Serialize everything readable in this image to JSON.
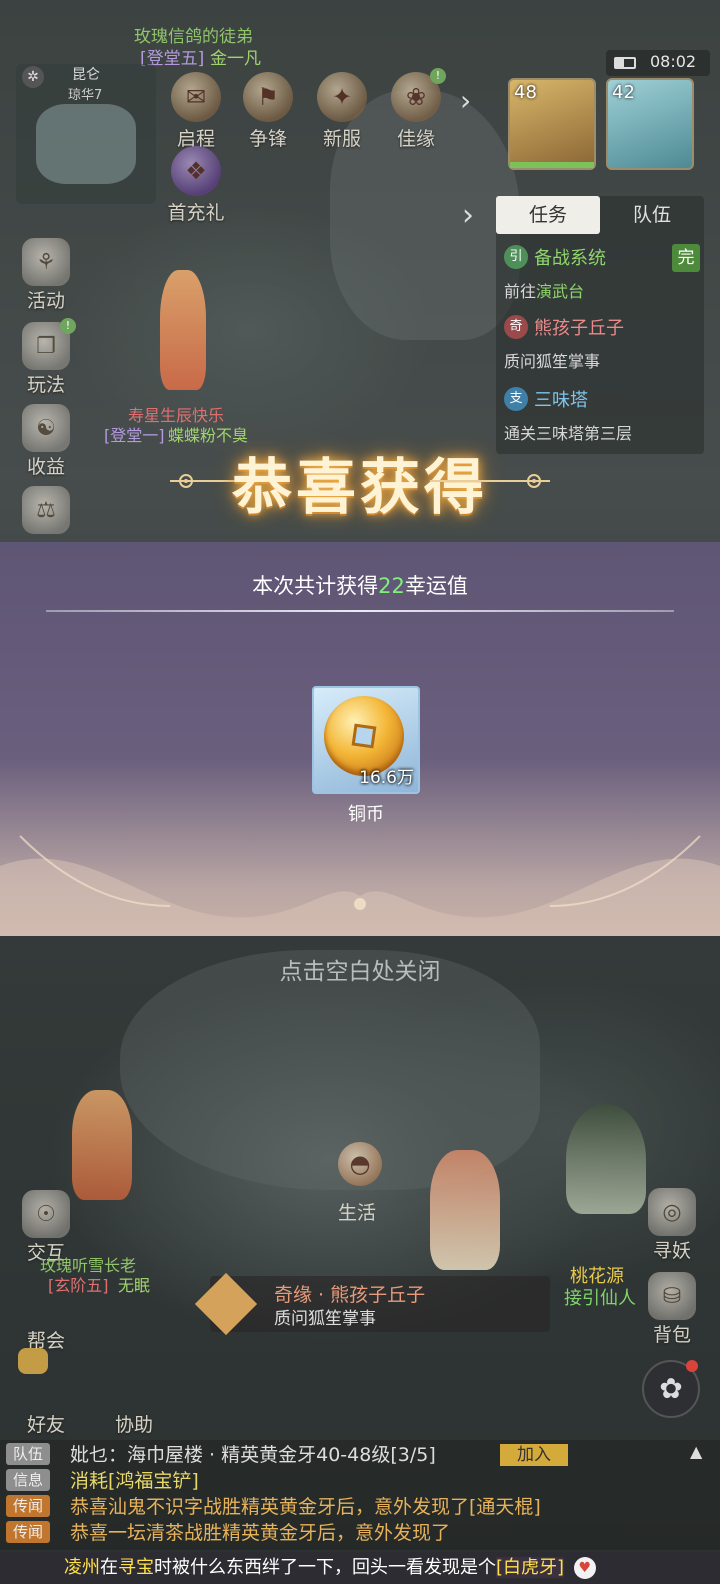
{
  "hud": {
    "top_player": "玫瑰信鸽的徒弟",
    "top_player_rank": "[登堂五]",
    "top_player_sub": "金一凡",
    "location": "昆仑",
    "location_sub": "琼华7",
    "time": "08:02",
    "mid_player": "寿星生辰快乐",
    "mid_player_rank": "[登堂一]",
    "mid_player_sub": "蝶蝶粉不臭",
    "bottom_left_player": "玫瑰听雪长老",
    "bottom_left_rank": "[玄阶五]",
    "bottom_left_sub": "无眠",
    "npc_name": "桃花源",
    "npc_sub": "接引仙人"
  },
  "top_menu": [
    {
      "label": "启程",
      "icon": "scroll-icon"
    },
    {
      "label": "争锋",
      "icon": "banner-icon"
    },
    {
      "label": "新服",
      "icon": "fan-icon"
    },
    {
      "label": "佳缘",
      "icon": "lantern-icon"
    }
  ],
  "top_menu_row2": {
    "label": "首充礼",
    "icon": "gift-box-icon"
  },
  "left_menu": [
    {
      "label": "活动",
      "icon": "gift-icon"
    },
    {
      "label": "玩法",
      "icon": "book-icon"
    },
    {
      "label": "收益",
      "icon": "bag-icon"
    }
  ],
  "avatars": [
    {
      "level": "48"
    },
    {
      "level": "42"
    }
  ],
  "quest_panel": {
    "tabs": [
      "任务",
      "队伍"
    ],
    "quests": [
      {
        "tag": "引",
        "name": "备战系统",
        "desc_prefix": "前往",
        "desc_highlight": "演武台",
        "status": "完",
        "tag_color": "#4f8f5a"
      },
      {
        "tag": "奇",
        "name": "熊孩子丘子",
        "desc": "质问狐笙掌事",
        "tag_color": "#9a4a4a"
      },
      {
        "tag": "支",
        "name": "三味塔",
        "desc": "通关三味塔第三层",
        "tag_color": "#3f7fa8"
      }
    ]
  },
  "reward": {
    "title": "恭喜获得",
    "summary_prefix": "本次共计获得",
    "summary_amount": "22",
    "summary_suffix": "幸运值",
    "item_name": "铜币",
    "item_qty": "16.6万",
    "close_hint": "点击空白处关闭"
  },
  "bottom_menu": {
    "life": "生活",
    "interact": "交互",
    "guild": "帮会",
    "friends": "好友",
    "assist": "协助",
    "seek": "寻妖",
    "bag": "背包"
  },
  "quest_tracker": {
    "title": "奇缘 · 熊孩子丘子",
    "desc": "质问狐笙掌事"
  },
  "chat": [
    {
      "channel": "队伍",
      "text": "妣乜：海巾屋楼 · 精英黄金牙40-48级[3/5]",
      "button": "加入"
    },
    {
      "channel": "信息",
      "text": "消耗[鸿福宝铲]"
    },
    {
      "channel": "传闻",
      "text": "恭喜汕鬼不识字战胜精英黄金牙后，意外发现了[通天棍]"
    },
    {
      "channel": "传闻",
      "text": "恭喜一坛清茶战胜精英黄金牙后，意外发现了"
    }
  ],
  "ticker": {
    "name": "凌州",
    "mid1": "在",
    "action": "寻宝",
    "mid2": "时被什么东西绊了一下，回头一看发现是个",
    "item": "[白虎牙]"
  }
}
